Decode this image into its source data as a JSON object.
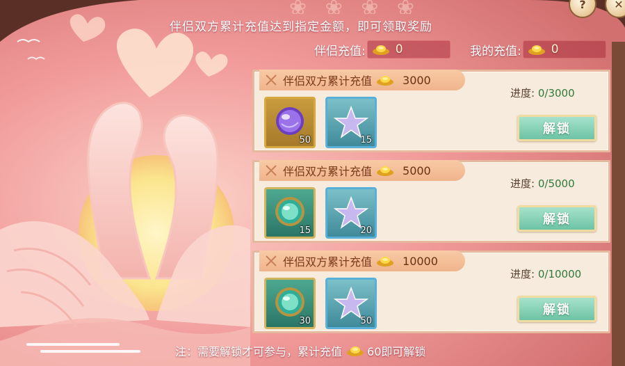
{
  "header": {
    "subtitle": "伴侣双方累计充值达到指定金额，即可领取奖励"
  },
  "recharge": {
    "partner_label": "伴侣充值:",
    "partner_value": "0",
    "mine_label": "我的充值:",
    "mine_value": "0"
  },
  "tiers": [
    {
      "title": "伴侣双方累计充值",
      "amount": "3000",
      "progress_label": "进度:",
      "progress_value": "0/3000",
      "button_label": "解锁",
      "items": [
        {
          "icon": "purple-orb-icon",
          "count": "50"
        },
        {
          "icon": "star-icon",
          "count": "15"
        }
      ]
    },
    {
      "title": "伴侣双方累计充值",
      "amount": "5000",
      "progress_label": "进度:",
      "progress_value": "0/5000",
      "button_label": "解锁",
      "items": [
        {
          "icon": "jade-orb-icon",
          "count": "15"
        },
        {
          "icon": "star-icon",
          "count": "20"
        }
      ]
    },
    {
      "title": "伴侣双方累计充值",
      "amount": "10000",
      "progress_label": "进度:",
      "progress_value": "0/10000",
      "button_label": "解锁",
      "items": [
        {
          "icon": "jade-orb-icon",
          "count": "30"
        },
        {
          "icon": "star-icon",
          "count": "50"
        }
      ]
    }
  ],
  "note": {
    "prefix": "注：需要解锁才可参与，累计充值",
    "suffix": "60即可解锁"
  },
  "colors": {
    "progress_value": "#2f7a3a",
    "unlock_button": "#6dc3a5",
    "card_background": "#f6ebdc",
    "ribbon": "#f0b48c"
  }
}
